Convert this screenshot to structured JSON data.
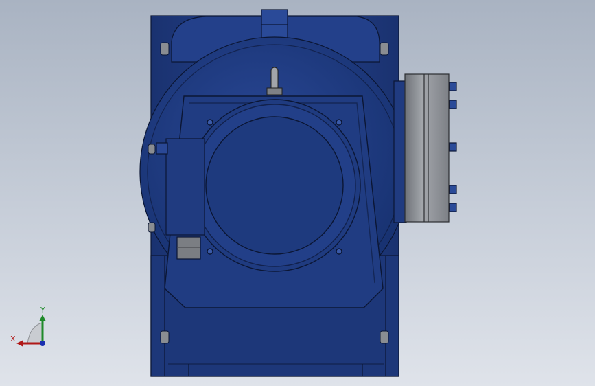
{
  "view": {
    "background_top": "#a9b3c2",
    "background_bottom": "#dfe3ea",
    "body_color": "#1f3a80",
    "body_dark": "#14275a",
    "flange_color": "#8a8d92"
  },
  "triad": {
    "x_label": "X",
    "y_label": "Y",
    "x_color": "#b01818",
    "y_color": "#1f8a2a",
    "z_color": "#1a2fb0"
  }
}
